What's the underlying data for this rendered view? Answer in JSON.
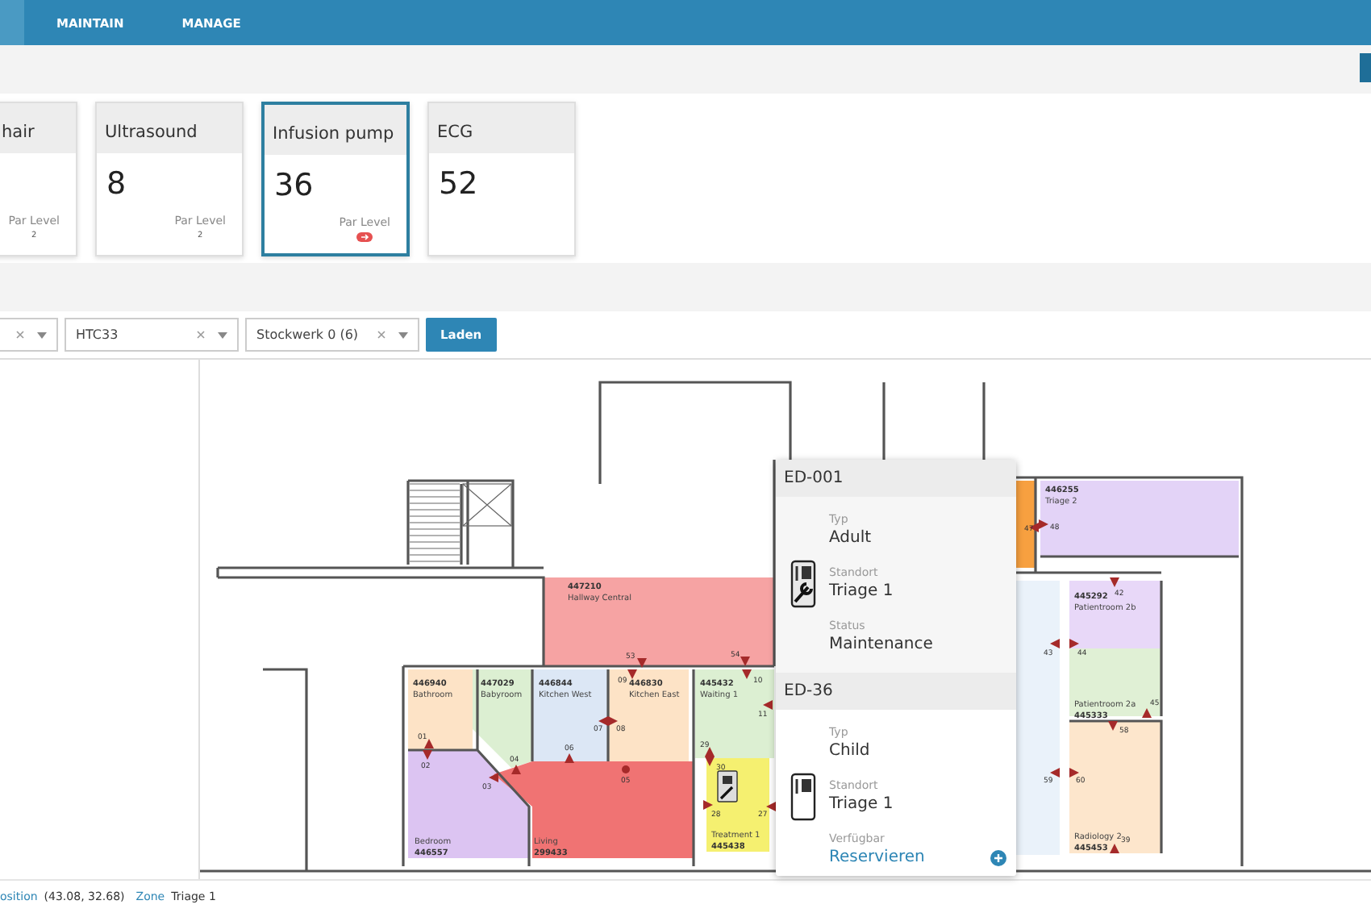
{
  "nav": {
    "tabs": [
      {
        "label": "MAINTAIN",
        "selected": false
      },
      {
        "label": "MANAGE",
        "selected": false
      }
    ]
  },
  "cards": [
    {
      "title": "hair",
      "par_label": "Par Level",
      "par_value": "2",
      "alert": false,
      "selected": false
    },
    {
      "title": "Ultrasound",
      "count": "8",
      "par_label": "Par Level",
      "par_value": "2",
      "alert": false,
      "selected": false
    },
    {
      "title": "Infusion pump",
      "count": "36",
      "par_label": "Par Level",
      "alert": true,
      "selected": true
    },
    {
      "title": "ECG",
      "count": "52",
      "alert": false,
      "selected": false
    }
  ],
  "filters": {
    "selects": [
      {
        "clearable": true
      },
      {
        "value": "HTC33",
        "clearable": true
      },
      {
        "value": "Stockwerk 0 (6)",
        "clearable": true
      }
    ],
    "button": "Laden"
  },
  "map": {
    "rooms": [
      {
        "number": "447210",
        "name": "Hallway Central",
        "color": "#f6a3a3"
      },
      {
        "number": "446940",
        "name": "Bathroom",
        "color": "#fde3c6"
      },
      {
        "number": "447029",
        "name": "Babyroom",
        "color": "#dcefd2"
      },
      {
        "number": "446844",
        "name": "Kitchen West",
        "color": "#dce7f5"
      },
      {
        "number": "446830",
        "name": "Kitchen East",
        "color": "#fde3c6"
      },
      {
        "number": "445432",
        "name": "Waiting 1",
        "color": "#dcefd2"
      },
      {
        "number": "445438",
        "name": "Treatment 1",
        "color": "#f5f070"
      },
      {
        "number": "446557",
        "name": "Bedroom",
        "color": "#dcc4f2"
      },
      {
        "number": "299433",
        "name": "Living",
        "color": "#f07373"
      },
      {
        "color": "#f7a040"
      },
      {
        "number": "446255",
        "name": "Triage 2",
        "color": "#e3d3f7"
      },
      {
        "number": "445292",
        "name": "Patientroom 2b",
        "color": "#e8d8f8"
      },
      {
        "number": "445333",
        "name": "Patientroom 2a",
        "color": "#e0f0d5"
      },
      {
        "number": "445453",
        "name": "Radiology 2",
        "color": "#fde6cc"
      },
      {
        "color": "#eaf2fa"
      }
    ],
    "markers": [
      {
        "label": "53"
      },
      {
        "label": "54"
      },
      {
        "label": "09"
      },
      {
        "label": "10"
      },
      {
        "label": "11"
      },
      {
        "label": "01"
      },
      {
        "label": "02"
      },
      {
        "label": "03"
      },
      {
        "label": "04"
      },
      {
        "label": "06"
      },
      {
        "label": "07"
      },
      {
        "label": "08"
      },
      {
        "label": "05"
      },
      {
        "label": "29"
      },
      {
        "label": "30"
      },
      {
        "label": "28"
      },
      {
        "label": "27"
      },
      {
        "label": "47"
      },
      {
        "label": "48"
      },
      {
        "label": "42"
      },
      {
        "label": "43"
      },
      {
        "label": "44"
      },
      {
        "label": "45"
      },
      {
        "label": "58"
      },
      {
        "label": "59"
      },
      {
        "label": "60"
      },
      {
        "label": "39"
      }
    ],
    "popup": [
      {
        "id": "ED-001",
        "maintenance": true,
        "fields": [
          {
            "label": "Typ",
            "value": "Adult",
            "kind": "text"
          },
          {
            "label": "Standort",
            "value": "Triage 1",
            "kind": "text"
          },
          {
            "label": "Status",
            "value": "Maintenance",
            "kind": "text"
          }
        ]
      },
      {
        "id": "ED-36",
        "maintenance": false,
        "fields": [
          {
            "label": "Typ",
            "value": "Child",
            "kind": "text"
          },
          {
            "label": "Standort",
            "value": "Triage 1",
            "kind": "text"
          },
          {
            "label": "Verfügbar",
            "value": "Reservieren",
            "kind": "link"
          }
        ]
      }
    ]
  },
  "status_bar": [
    {
      "label": "osition",
      "value": "(43.08, 32.68)"
    },
    {
      "label": "Zone",
      "value": "Triage 1"
    }
  ]
}
